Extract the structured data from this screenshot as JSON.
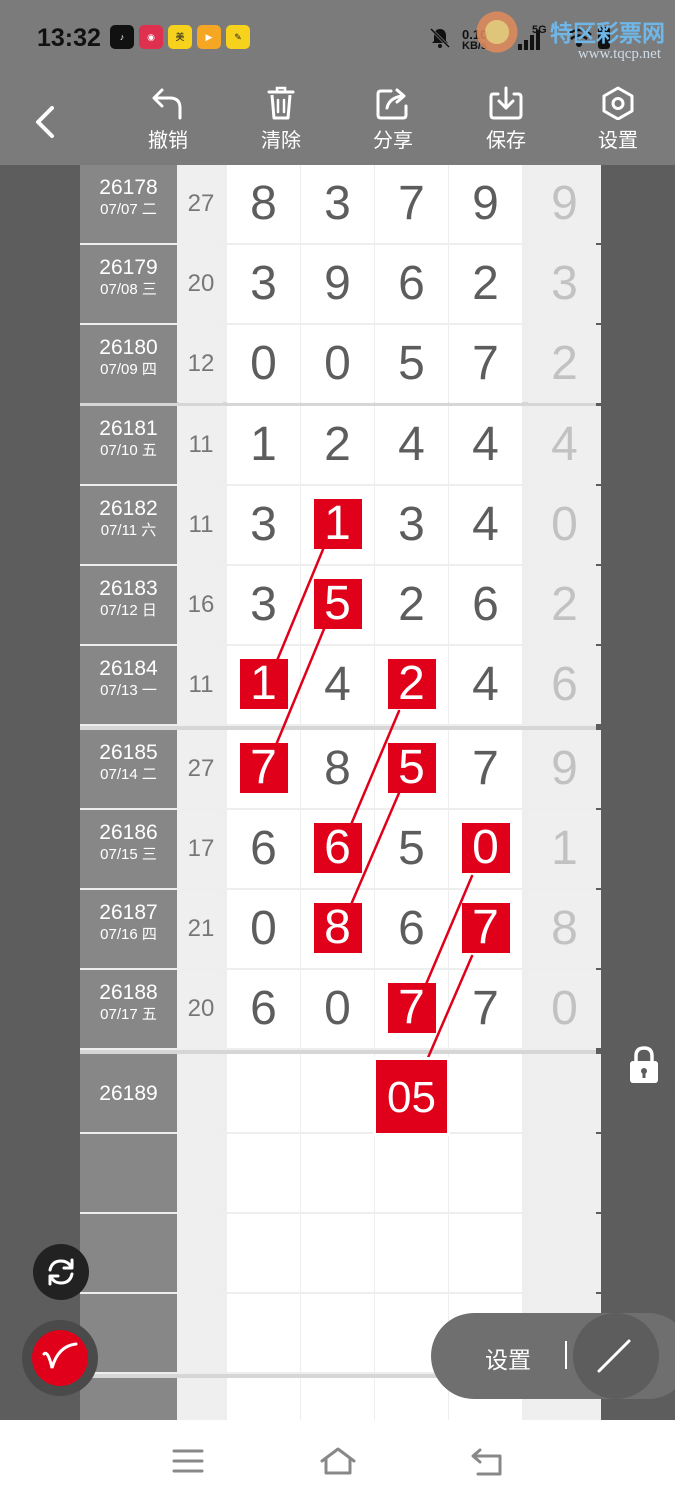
{
  "status_bar": {
    "time": "13:32",
    "net_speed_value": "0.10",
    "net_speed_unit": "KB/s",
    "network": "5G",
    "app_icons": [
      "tiktok-icon",
      "pinduoduo-icon",
      "meituan-icon",
      "video-icon",
      "notes-icon"
    ]
  },
  "watermark": {
    "brand": "特区彩票网",
    "url": "www.tqcp.net"
  },
  "toolbar": {
    "undo_label": "撤销",
    "clear_label": "清除",
    "share_label": "分享",
    "save_label": "保存",
    "settings_label": "设置"
  },
  "rows": [
    {
      "period": "26178",
      "date": "07/07 二",
      "sum": "27",
      "digits": [
        "8",
        "3",
        "7",
        "9"
      ],
      "extra": "9"
    },
    {
      "period": "26179",
      "date": "07/08 三",
      "sum": "20",
      "digits": [
        "3",
        "9",
        "6",
        "2"
      ],
      "extra": "3"
    },
    {
      "period": "26180",
      "date": "07/09 四",
      "sum": "12",
      "digits": [
        "0",
        "0",
        "5",
        "7"
      ],
      "extra": "2"
    },
    {
      "period": "26181",
      "date": "07/10 五",
      "sum": "11",
      "digits": [
        "1",
        "2",
        "4",
        "4"
      ],
      "extra": "4"
    },
    {
      "period": "26182",
      "date": "07/11 六",
      "sum": "11",
      "digits": [
        "3",
        "1",
        "3",
        "4"
      ],
      "extra": "0"
    },
    {
      "period": "26183",
      "date": "07/12 日",
      "sum": "16",
      "digits": [
        "3",
        "5",
        "2",
        "6"
      ],
      "extra": "2"
    },
    {
      "period": "26184",
      "date": "07/13 一",
      "sum": "11",
      "digits": [
        "1",
        "4",
        "2",
        "4"
      ],
      "extra": "6"
    },
    {
      "period": "26185",
      "date": "07/14 二",
      "sum": "27",
      "digits": [
        "7",
        "8",
        "5",
        "7"
      ],
      "extra": "9"
    },
    {
      "period": "26186",
      "date": "07/15 三",
      "sum": "17",
      "digits": [
        "6",
        "6",
        "5",
        "0"
      ],
      "extra": "1"
    },
    {
      "period": "26187",
      "date": "07/16 四",
      "sum": "21",
      "digits": [
        "0",
        "8",
        "6",
        "7"
      ],
      "extra": "8"
    },
    {
      "period": "26188",
      "date": "07/17 五",
      "sum": "20",
      "digits": [
        "6",
        "0",
        "7",
        "7"
      ],
      "extra": "0"
    },
    {
      "period": "26189",
      "date": "",
      "sum": "",
      "digits": [
        "",
        "",
        "",
        ""
      ],
      "extra": ""
    }
  ],
  "highlights": [
    {
      "row": 4,
      "col": 1
    },
    {
      "row": 5,
      "col": 1
    },
    {
      "row": 6,
      "col": 0
    },
    {
      "row": 6,
      "col": 2
    },
    {
      "row": 7,
      "col": 0
    },
    {
      "row": 7,
      "col": 2
    },
    {
      "row": 8,
      "col": 1
    },
    {
      "row": 8,
      "col": 3
    },
    {
      "row": 9,
      "col": 1
    },
    {
      "row": 9,
      "col": 3
    },
    {
      "row": 10,
      "col": 2
    }
  ],
  "prediction": "05",
  "bottom_panel": {
    "settings_label": "设置"
  },
  "colors": {
    "highlight": "#e0001a",
    "toolbar": "#7b7b7b",
    "period_column": "#878787"
  }
}
